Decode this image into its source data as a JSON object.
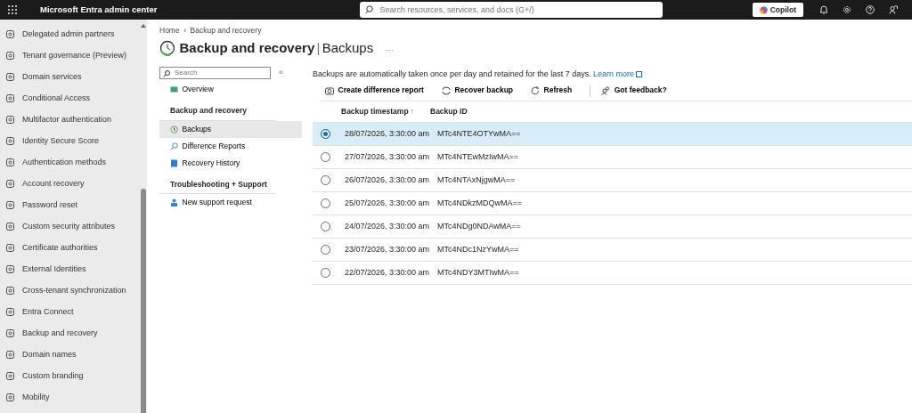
{
  "header": {
    "title": "Microsoft Entra admin center",
    "search": {
      "placeholder": "Search resources, services, and docs (G+/)"
    },
    "copilot": "Copilot"
  },
  "sidebar": {
    "items": [
      {
        "label": "Delegated admin partners"
      },
      {
        "label": "Tenant governance (Preview)"
      },
      {
        "label": "Domain services"
      },
      {
        "label": "Conditional Access"
      },
      {
        "label": "Multifactor authentication"
      },
      {
        "label": "Identity Secure Score"
      },
      {
        "label": "Authentication methods"
      },
      {
        "label": "Account recovery"
      },
      {
        "label": "Password reset"
      },
      {
        "label": "Custom security attributes"
      },
      {
        "label": "Certificate authorities"
      },
      {
        "label": "External Identities"
      },
      {
        "label": "Cross-tenant synchronization"
      },
      {
        "label": "Entra Connect"
      },
      {
        "label": "Backup and recovery"
      },
      {
        "label": "Domain names"
      },
      {
        "label": "Custom branding"
      },
      {
        "label": "Mobility"
      }
    ]
  },
  "breadcrumb": {
    "items": [
      "Home",
      "Backup and recovery"
    ],
    "separator": "›"
  },
  "page": {
    "title": "Backup and recovery",
    "divider": "|",
    "subtitle": "Backups",
    "more": "···"
  },
  "menu": {
    "search": {
      "placeholder": "Search"
    },
    "collapse": "«",
    "items": [
      {
        "kind": "link",
        "label": "Overview",
        "selected": false
      },
      {
        "kind": "heading",
        "label": "Backup and recovery"
      },
      {
        "kind": "link",
        "label": "Backups",
        "selected": true
      },
      {
        "kind": "link",
        "label": "Difference Reports",
        "selected": false
      },
      {
        "kind": "link",
        "label": "Recovery History",
        "selected": false
      },
      {
        "kind": "heading",
        "label": "Troubleshooting + Support"
      },
      {
        "kind": "link",
        "label": "New support request",
        "selected": false
      }
    ]
  },
  "info": {
    "text": "Backups are automatically taken once per day and retained for the last 7 days.",
    "link": "Learn more"
  },
  "toolbar": [
    "Create difference report",
    "Recover backup",
    "Refresh",
    "Got feedback?"
  ],
  "table": {
    "columns": [
      "Backup timestamp",
      "Backup ID"
    ],
    "sort_arrow": "↑",
    "rows": [
      {
        "timestamp": "28/07/2026, 3:30:00 am",
        "id": "MTc4NTE4OTYwMA==",
        "selected": true
      },
      {
        "timestamp": "27/07/2026, 3:30:00 am",
        "id": "MTc4NTEwMzIwMA==",
        "selected": false
      },
      {
        "timestamp": "26/07/2026, 3:30:00 am",
        "id": "MTc4NTAxNjgwMA==",
        "selected": false
      },
      {
        "timestamp": "25/07/2026, 3:30:00 am",
        "id": "MTc4NDkzMDQwMA==",
        "selected": false
      },
      {
        "timestamp": "24/07/2026, 3:30:00 am",
        "id": "MTc4NDg0NDAwMA==",
        "selected": false
      },
      {
        "timestamp": "23/07/2026, 3:30:00 am",
        "id": "MTc4NDc1NzYwMA==",
        "selected": false
      },
      {
        "timestamp": "22/07/2026, 3:30:00 am",
        "id": "MTc4NDY3MTIwMA==",
        "selected": false
      }
    ]
  }
}
